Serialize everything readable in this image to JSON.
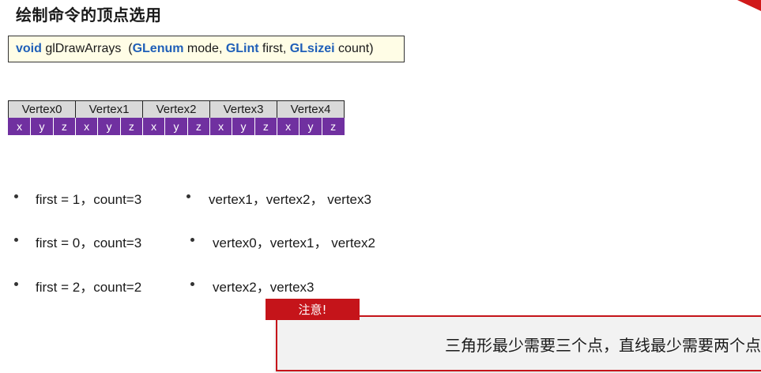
{
  "page": {
    "title": "绘制命令的顶点选用",
    "accent_color": "#d0191a"
  },
  "signature": {
    "ret": "void",
    "fn": " glDrawArrays  (",
    "t1": "GLenum",
    "p1": " mode, ",
    "t2": "GLint",
    "p2": " first, ",
    "t3": "GLsizei",
    "p3": " count)"
  },
  "vertex_table": {
    "headers": [
      "Vertex0",
      "Vertex1",
      "Vertex2",
      "Vertex3",
      "Vertex4"
    ],
    "components": [
      "x",
      "y",
      "z"
    ],
    "header_color": "#d9d9d9",
    "component_color": "#7030a0"
  },
  "examples": [
    {
      "params": "first = 1，count=3",
      "result": "vertex1，vertex2， vertex3"
    },
    {
      "params": "first = 0，count=3",
      "result": "vertex0，vertex1， vertex2"
    },
    {
      "params": "first = 2，count=2",
      "result": "vertex2，vertex3"
    }
  ],
  "note": {
    "label": "注意!",
    "text": "三角形最少需要三个点，直线最少需要两个点",
    "color": "#c5141a"
  }
}
